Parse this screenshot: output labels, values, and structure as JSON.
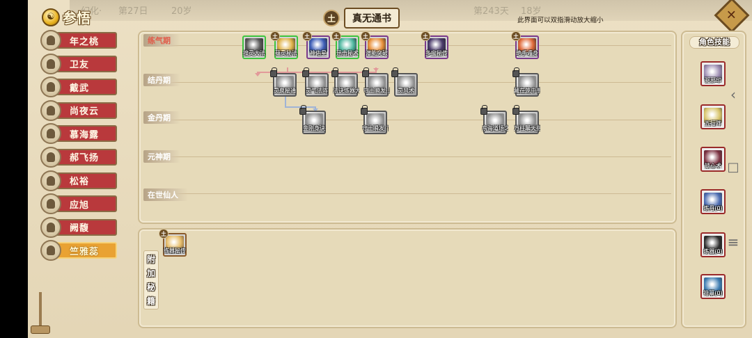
{
  "header": {
    "title": "参悟",
    "element_badge": "土",
    "book_title": "真无通书",
    "hint": "此界面可以双指滑动放大缩小",
    "close_label": "✕"
  },
  "characters": [
    {
      "name": "年之桃",
      "active": false
    },
    {
      "name": "卫友",
      "active": false
    },
    {
      "name": "戴武",
      "active": false
    },
    {
      "name": "尚夜云",
      "active": false
    },
    {
      "name": "慕海露",
      "active": false
    },
    {
      "name": "郝飞扬",
      "active": false
    },
    {
      "name": "松裕",
      "active": false
    },
    {
      "name": "应旭",
      "active": false
    },
    {
      "name": "阙馥",
      "active": false
    },
    {
      "name": "竺雅蕊",
      "active": true
    }
  ],
  "realms": [
    "练气期",
    "结丹期",
    "金丹期",
    "元神期",
    "在世仙人"
  ],
  "nodes": [
    {
      "label": "搜灵大法",
      "state": "green",
      "badge": "",
      "color": "#5c5c5c"
    },
    {
      "label": "蕴灵秘法",
      "state": "green",
      "badge": "土",
      "color": "#e0b34a"
    },
    {
      "label": "神佑星",
      "state": "lit",
      "badge": "土",
      "color": "#3f5fb8"
    },
    {
      "label": "迅击秘术",
      "state": "green",
      "badge": "土",
      "color": "#4fb8a0"
    },
    {
      "label": "潜能突破",
      "state": "lit",
      "badge": "土",
      "color": "#e8903a"
    },
    {
      "label": "多宝秘传",
      "state": "lit",
      "badge": "土",
      "color": "#4a3a6a"
    },
    {
      "label": "绝手遁身",
      "state": "lit",
      "badge": "土",
      "color": "#e06a3a"
    },
    {
      "label": "灵泉秘通",
      "state": "gray",
      "badge": "",
      "color": "#b5b5b5"
    },
    {
      "label": "灵气法阵",
      "state": "gray",
      "badge": "",
      "color": "#b5b5b5"
    },
    {
      "label": "法诀炼器大成",
      "state": "gray",
      "badge": "",
      "color": "#b5b5b5"
    },
    {
      "label": "守土瞬发·上卷",
      "state": "gray",
      "badge": "",
      "color": "#b5b5b5"
    },
    {
      "label": "灵风术",
      "state": "gray",
      "badge": "",
      "color": "#b5b5b5"
    },
    {
      "label": "藏在笼中手下册",
      "state": "gray",
      "badge": "",
      "color": "#b5b5b5"
    },
    {
      "label": "金刚身诀",
      "state": "gray",
      "badge": "",
      "color": "#b5b5b5"
    },
    {
      "label": "守土瞬发·下卷",
      "state": "gray",
      "badge": "",
      "color": "#b5b5b5"
    },
    {
      "label": "东海道场之王手册",
      "state": "gray",
      "badge": "",
      "color": "#b5b5b5"
    },
    {
      "label": "万柱擎天指",
      "state": "gray",
      "badge": "",
      "color": "#b5b5b5"
    }
  ],
  "extra": {
    "label_chars": [
      "附",
      "加",
      "秘",
      "籍"
    ],
    "node": {
      "label": "练器秘传",
      "badge": "土",
      "color": "#e8c070"
    }
  },
  "skills": {
    "title": "角色技能",
    "items": [
      {
        "label": "驱邪印",
        "color": "#9a8ab0"
      },
      {
        "label": "五行阵",
        "color": "#d7c36a"
      },
      {
        "label": "锁心术",
        "color": "#7a3040"
      },
      {
        "label": "炼丹(0)",
        "color": "#4a6ab0"
      },
      {
        "label": "炼器(0)",
        "color": "#2a2a2a"
      },
      {
        "label": "符箓(0)",
        "color": "#3a7ab0"
      }
    ]
  },
  "background_ghost": [
    "幻化·",
    "第27日",
    "20岁",
    "第243天",
    "18岁"
  ],
  "system_nav": [
    "‹",
    "□",
    "≡"
  ]
}
